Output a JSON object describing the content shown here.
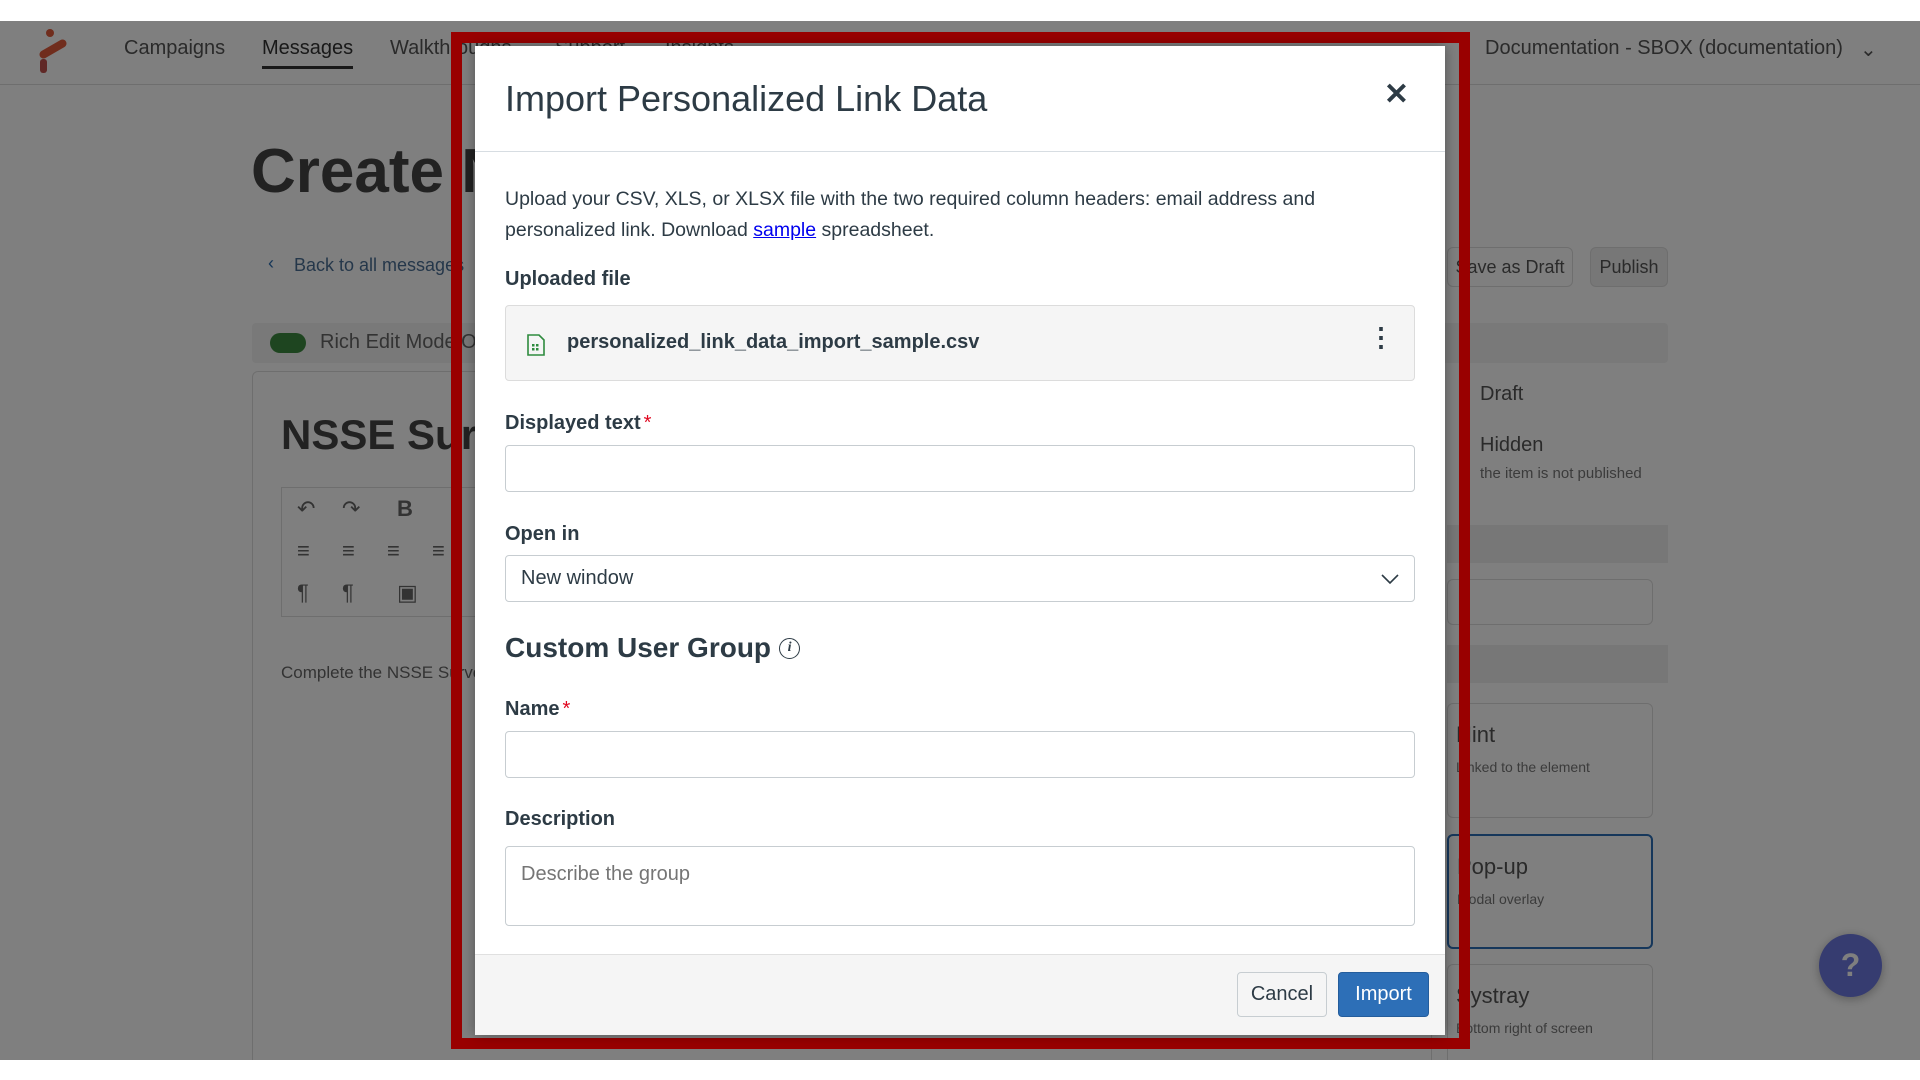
{
  "background": {
    "nav": {
      "items": [
        {
          "label": "Campaigns",
          "active": false
        },
        {
          "label": "Messages",
          "active": true
        },
        {
          "label": "Walkthroughs",
          "active": false
        },
        {
          "label": "Support",
          "active": false
        },
        {
          "label": "Insights",
          "active": false
        }
      ],
      "account": "Documentation - SBOX (documentation)"
    },
    "page_title": "Create N",
    "back_link": "Back to all messages",
    "save_draft": "Save as Draft",
    "publish": "Publish",
    "rich_edit": "Rich Edit Mode On",
    "message_title": "NSSE Survey",
    "message_body": "Complete the NSSE Survey",
    "status": {
      "draft": "Draft",
      "hidden": "Hidden",
      "hidden_sub": "the item is not published"
    },
    "cards": [
      {
        "title": "Hint",
        "sub": "Linked to the element"
      },
      {
        "title": "Pop-up",
        "sub": "Modal overlay"
      },
      {
        "title": "Systray",
        "sub": "Bottom right of screen"
      }
    ],
    "help_icon": "question-circle-icon"
  },
  "modal": {
    "title": "Import Personalized Link Data",
    "intro_before": "Upload your CSV, XLS, or XLSX file with the two required column headers: email address and personalized link. Download ",
    "intro_link": "sample",
    "intro_after": " spreadsheet.",
    "uploaded_label": "Uploaded file",
    "file_name": "personalized_link_data_import_sample.csv",
    "displayed_text_label": "Displayed text",
    "displayed_text_value": "",
    "open_in_label": "Open in",
    "open_in_value": "New window",
    "group_heading": "Custom User Group",
    "name_label": "Name",
    "name_value": "",
    "description_label": "Description",
    "description_placeholder": "Describe the group",
    "required_mark": "*",
    "cancel": "Cancel",
    "import": "Import"
  },
  "colors": {
    "highlight_frame": "#990000",
    "primary": "#2d6fb7",
    "link": "#0000ee",
    "required": "#e0061f"
  }
}
